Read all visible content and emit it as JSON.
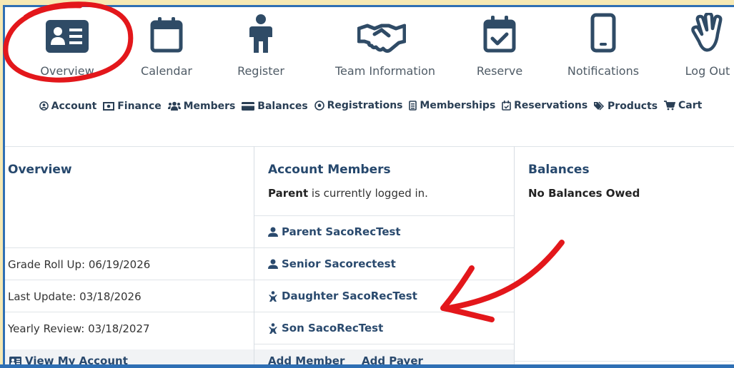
{
  "topnav": [
    {
      "label": "Overview",
      "icon": "id-card-icon"
    },
    {
      "label": "Calendar",
      "icon": "calendar-icon"
    },
    {
      "label": "Register",
      "icon": "person-icon"
    },
    {
      "label": "Team Information",
      "icon": "handshake-icon"
    },
    {
      "label": "Reserve",
      "icon": "calendar-check-icon"
    },
    {
      "label": "Notifications",
      "icon": "mobile-phone-icon"
    },
    {
      "label": "Log Out",
      "icon": "waving-hand-icon"
    }
  ],
  "subnav": [
    {
      "label": "Account",
      "icon": "user-circle-icon"
    },
    {
      "label": "Finance",
      "icon": "money-bill-icon"
    },
    {
      "label": "Members",
      "icon": "users-icon"
    },
    {
      "label": "Balances",
      "icon": "credit-card-icon"
    },
    {
      "label": "Registrations",
      "icon": "futbol-icon"
    },
    {
      "label": "Memberships",
      "icon": "id-badge-icon"
    },
    {
      "label": "Reservations",
      "icon": "calendar-check-icon"
    },
    {
      "label": "Products",
      "icon": "tags-icon"
    },
    {
      "label": "Cart",
      "icon": "shopping-cart-icon"
    }
  ],
  "overview": {
    "title": "Overview",
    "grade_roll_up": "Grade Roll Up: 06/19/2026",
    "last_update": "Last Update: 03/18/2026",
    "yearly_review": "Yearly Review: 03/18/2027",
    "view_account": "View My Account"
  },
  "members": {
    "title": "Account Members",
    "logged_in_name": "Parent",
    "logged_in_suffix": " is currently logged in.",
    "list": [
      {
        "name": "Parent SacoRecTest",
        "icon": "user-icon"
      },
      {
        "name": "Senior Sacorectest",
        "icon": "user-icon"
      },
      {
        "name": "Daughter SacoRecTest",
        "icon": "child-icon"
      },
      {
        "name": "Son SacoRecTest",
        "icon": "child-icon"
      }
    ],
    "add_member": "Add Member",
    "add_payer": "Add Payer"
  },
  "balances": {
    "title": "Balances",
    "status": "No Balances Owed"
  },
  "colors": {
    "accent": "#2a4a6e",
    "frame": "#2e6fb4",
    "background": "#f6e9b4",
    "annotation": "#e3171b"
  }
}
